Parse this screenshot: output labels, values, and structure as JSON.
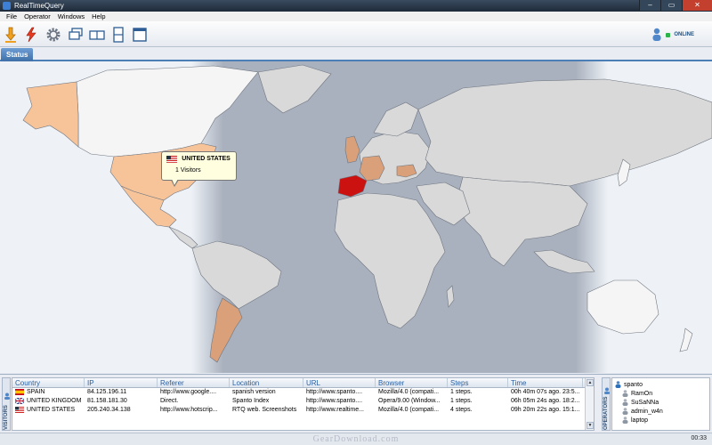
{
  "window": {
    "title": "RealTimeQuery",
    "minimize": "–",
    "maximize": "▭",
    "close": "✕"
  },
  "menu": [
    "File",
    "Operator",
    "Windows",
    "Help"
  ],
  "toolbar": {
    "status_label": "ONLINE"
  },
  "tabs": [
    {
      "label": "Status"
    }
  ],
  "tooltip": {
    "country": "UNITED STATES",
    "visitors": "1 Visitors"
  },
  "visitors_panel": {
    "side_label": "VISITORS",
    "columns": [
      "Country",
      "IP",
      "Referer",
      "Location",
      "URL",
      "Browser",
      "Steps",
      "Time"
    ],
    "rows": [
      {
        "country": "SPAIN",
        "ip": "84.125.196.11",
        "referer": "http://www.google....",
        "location": "spanish version",
        "url": "http://www.spanto....",
        "browser": "Mozilla/4.0 (compati...",
        "steps": "1 steps.",
        "time": "00h 40m 07s ago. 23:5..."
      },
      {
        "country": "UNITED KINGDOM",
        "ip": "81.158.181.30",
        "referer": "Direct.",
        "location": "Spanto Index",
        "url": "http://www.spanto....",
        "browser": "Opera/9.00 (Window...",
        "steps": "1 steps.",
        "time": "06h 05m 24s ago. 18:2..."
      },
      {
        "country": "UNITED STATES",
        "ip": "205.240.34.138",
        "referer": "http://www.hotscrip...",
        "location": "RTQ web. Screenshots",
        "url": "http://www.realtime...",
        "browser": "Mozilla/4.0 (compati...",
        "steps": "4 steps.",
        "time": "09h 20m 22s ago. 15:1..."
      }
    ]
  },
  "operators_panel": {
    "side_label": "OPERATORS",
    "items": [
      "spanto",
      "RamOn",
      "SuSaNNa",
      "admin_w4n",
      "laptop"
    ]
  },
  "statusbar": {
    "watermark": "GearDownload.com",
    "clock": "00:33"
  },
  "colors": {
    "highlight_strong": "#cc1111",
    "highlight_light": "#f7c49a",
    "highlight_medium": "#d9a07a",
    "ocean": "#a9b1be",
    "land": "#d9d9d9",
    "accent": "#4d7fb7"
  }
}
